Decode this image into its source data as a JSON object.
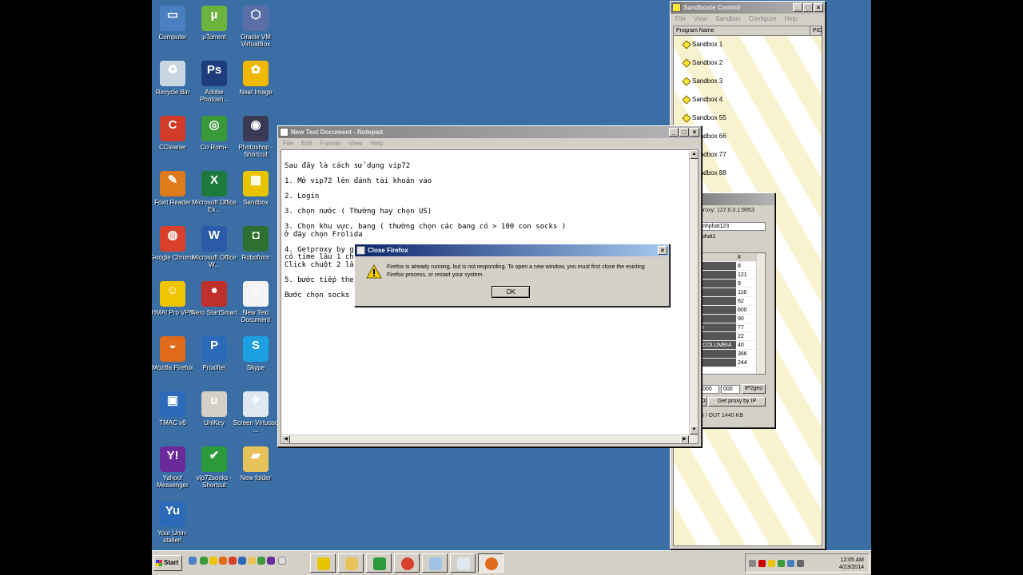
{
  "desktop": {
    "icons": [
      {
        "label": "Computer",
        "color": "#4a7fc1",
        "glyph": "▭"
      },
      {
        "label": "µTorrent",
        "color": "#6cb33f",
        "glyph": "µ"
      },
      {
        "label": "Oracle VM VirtualBox",
        "color": "#5a6fa8",
        "glyph": "⬡"
      },
      {
        "label": "Recycle Bin",
        "color": "#c9d6e2",
        "glyph": "♻"
      },
      {
        "label": "Adobe Photosh...",
        "color": "#1f3d7a",
        "glyph": "Ps"
      },
      {
        "label": "Neat Image",
        "color": "#f0b800",
        "glyph": "✿"
      },
      {
        "label": "CCleaner",
        "color": "#d23a2a",
        "glyph": "C"
      },
      {
        "label": "Co Rom+",
        "color": "#3a9a3a",
        "glyph": "◎"
      },
      {
        "label": "Photoshop - Shortcut",
        "color": "#3a3a55",
        "glyph": "◉"
      },
      {
        "label": "Foxit Reader",
        "color": "#e07a1a",
        "glyph": "✎"
      },
      {
        "label": "Microsoft Office Ex...",
        "color": "#1e7a3c",
        "glyph": "X"
      },
      {
        "label": "Sandbox",
        "color": "#e8c400",
        "glyph": "▦"
      },
      {
        "label": "Google Chrome",
        "color": "#d8402b",
        "glyph": "◍"
      },
      {
        "label": "Microsoft Office W...",
        "color": "#2a5aa8",
        "glyph": "W"
      },
      {
        "label": "Roboform",
        "color": "#2f6f2f",
        "glyph": "◘"
      },
      {
        "label": "HMA! Pro VPN",
        "color": "#f0c400",
        "glyph": "☺"
      },
      {
        "label": "Nero StartSmart",
        "color": "#c0302a",
        "glyph": "●"
      },
      {
        "label": "New Text Document",
        "color": "#f4f4f4",
        "glyph": "≡"
      },
      {
        "label": "Mozilla Firefox",
        "color": "#e06a1a",
        "glyph": "◒"
      },
      {
        "label": "Proxifier",
        "color": "#2a6ab8",
        "glyph": "P"
      },
      {
        "label": "Skype",
        "color": "#1ba0e2",
        "glyph": "S"
      },
      {
        "label": "TMAC v6",
        "color": "#2a6ab8",
        "glyph": "▣"
      },
      {
        "label": "UniKey",
        "color": "#d4d0c8",
        "glyph": "u"
      },
      {
        "label": "Screen Virtuoso ...",
        "color": "#dfe8f0",
        "glyph": "✈"
      },
      {
        "label": "Yahoo! Messenger",
        "color": "#6a2a9a",
        "glyph": "Y!"
      },
      {
        "label": "vip72socks - Shortcut",
        "color": "#2a9a3a",
        "glyph": "✔"
      },
      {
        "label": "New folder",
        "color": "#e8c25a",
        "glyph": "▰"
      },
      {
        "label": "Your Unin-staller!",
        "color": "#2a6ab8",
        "glyph": "Yu"
      }
    ]
  },
  "notepad": {
    "title": "New Text Document - Notepad",
    "menu": [
      "File",
      "Edit",
      "Format",
      "View",
      "Help"
    ],
    "text": "Sau đây là cách sử dụng vip72\n\n1. Mở vip72 lên đánh tài khoản vào\n\n2. Login\n\n3. chọn nước ( Thường hay chọn US)\n\n3. Chọn khu vực, bang ( thường chọn các bang có > 100 con socks )\nở đây chọn Frolida\n\n4. Getproxy by g                                                      cks\ncó time lâu 1 ch\nClick chuột 2 lần\n\n5. bước tiếp theo\n\nBước chọn socks đ"
  },
  "sandboxie": {
    "title": "Sandboxie Control",
    "menu": [
      "File",
      "View",
      "Sandbox",
      "Configure",
      "Help"
    ],
    "col_program": "Program Name",
    "col_pid": "PID",
    "boxes": [
      "Sandbox 1",
      "Sandbox 2",
      "Sandbox 3",
      "Sandbox 4",
      "Sandbox 55",
      "Sandbox 66",
      "Sandbox 77",
      "Sandbox 88"
    ]
  },
  "proxy": {
    "proxy_label": "proxy:  127.0.0.1:9953",
    "user": "nhphat123",
    "pass": "phat1",
    "col_hash": "#",
    "rows": [
      {
        "name": "",
        "count": "8"
      },
      {
        "name": "",
        "count": "121"
      },
      {
        "name": "",
        "count": "9"
      },
      {
        "name": "",
        "count": "118"
      },
      {
        "name": "",
        "count": "62"
      },
      {
        "name": "",
        "count": "600"
      },
      {
        "name": "",
        "count": "90"
      },
      {
        "name": "r",
        "count": "77"
      },
      {
        "name": "",
        "count": "22"
      },
      {
        "name": "COLUMBIA",
        "count": "40"
      },
      {
        "name": "",
        "count": "366"
      },
      {
        "name": "",
        "count": "244"
      }
    ],
    "ip_a": "000",
    "ip_b": "000",
    "ip2geo": "IP2geo",
    "left_btn": "D",
    "get_proxy": "Get proxy by IP",
    "stats": "B / OUT 1440 KB"
  },
  "dialog": {
    "title": "Close Firefox",
    "message": "Firefox is already running, but is not responding. To open a new window, you must first close the existing Firefox process, or restart your system.",
    "ok": "OK"
  },
  "taskbar": {
    "start": "Start",
    "time": "12:05 AM",
    "date": "4/23/2014"
  }
}
